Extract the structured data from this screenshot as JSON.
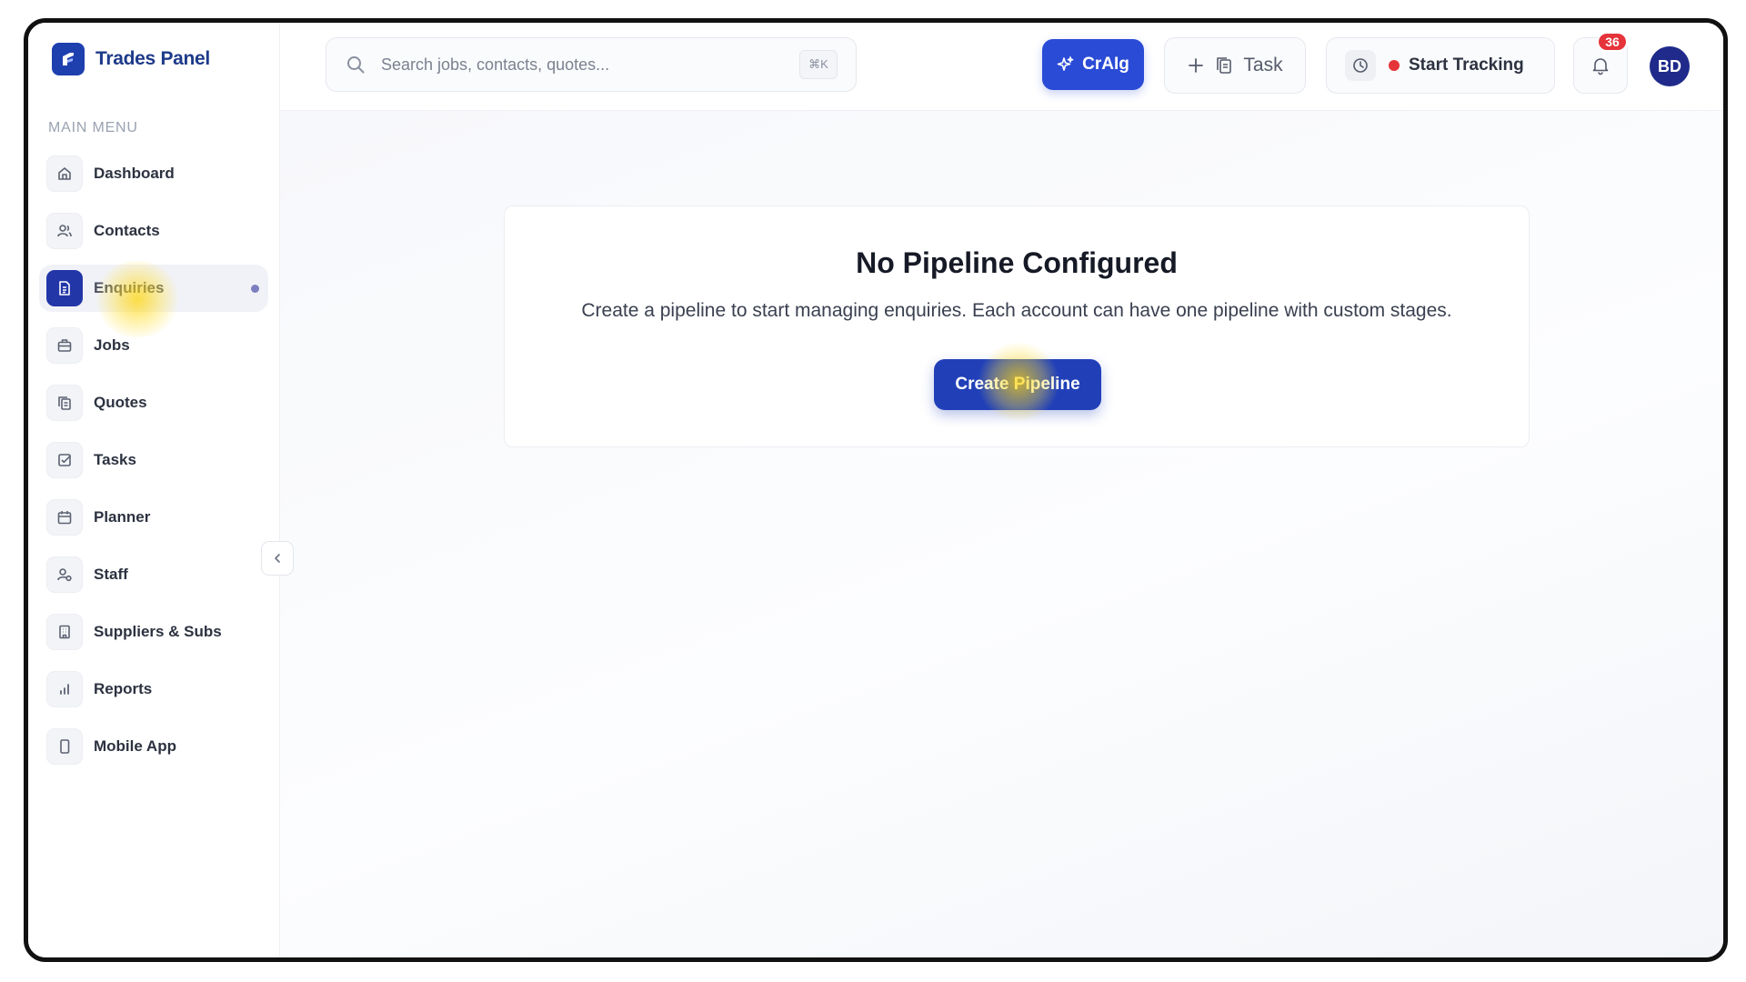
{
  "app": {
    "name": "Trades Panel"
  },
  "sidebar": {
    "section_title": "MAIN MENU",
    "items": [
      {
        "label": "Dashboard",
        "icon": "home-icon"
      },
      {
        "label": "Contacts",
        "icon": "users-icon"
      },
      {
        "label": "Enquiries",
        "icon": "document-icon",
        "active": true
      },
      {
        "label": "Jobs",
        "icon": "briefcase-icon"
      },
      {
        "label": "Quotes",
        "icon": "copy-icon"
      },
      {
        "label": "Tasks",
        "icon": "checkbox-icon"
      },
      {
        "label": "Planner",
        "icon": "calendar-icon"
      },
      {
        "label": "Staff",
        "icon": "staff-icon"
      },
      {
        "label": "Suppliers & Subs",
        "icon": "building-icon"
      },
      {
        "label": "Reports",
        "icon": "bar-chart-icon"
      },
      {
        "label": "Mobile App",
        "icon": "phone-icon"
      }
    ]
  },
  "header": {
    "search_placeholder": "Search jobs, contacts, quotes...",
    "search_shortcut": "⌘K",
    "ai_label": "CrAIg",
    "task_label": "Task",
    "tracking_label": "Start Tracking",
    "notification_count": "36",
    "avatar_initials": "BD"
  },
  "main": {
    "empty_title": "No Pipeline Configured",
    "empty_description": "Create a pipeline to start managing enquiries. Each account can have one pipeline with custom stages.",
    "cta_label": "Create Pipeline"
  },
  "colors": {
    "brand": "#1e3a8a",
    "primary": "#2140b8",
    "ai_button": "#2a4bd6",
    "tracking_dot": "#e5343a",
    "badge": "#e5343a",
    "highlight": "#ffd60a"
  }
}
